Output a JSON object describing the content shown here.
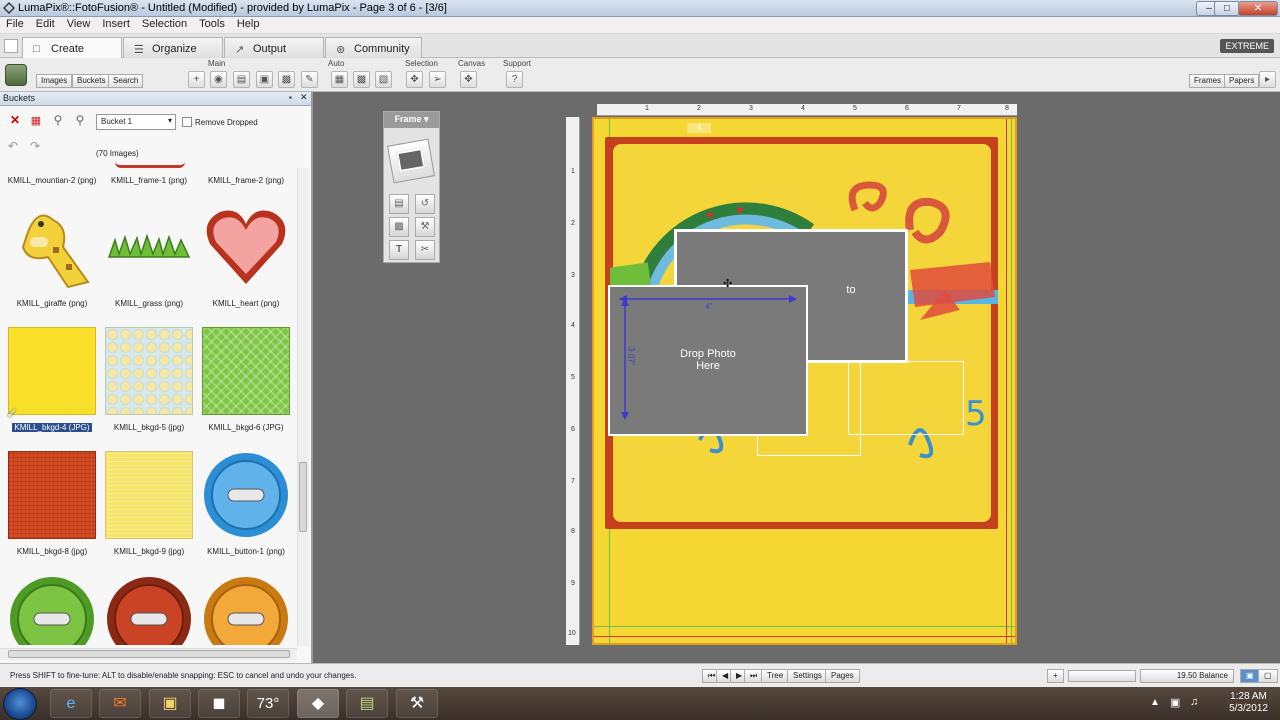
{
  "window": {
    "title": "LumaPix®::FotoFusion® - Untitled (Modified) - provided by LumaPix - Page 3 of 6 - [3/6]",
    "controls": [
      "–",
      "□",
      "✕"
    ]
  },
  "menu": [
    "File",
    "Edit",
    "View",
    "Insert",
    "Selection",
    "Tools",
    "Help"
  ],
  "tabs": [
    {
      "label": "Create",
      "icon": "create-icon"
    },
    {
      "label": "Organize",
      "icon": "list-icon"
    },
    {
      "label": "Output",
      "icon": "output-icon"
    },
    {
      "label": "Community",
      "icon": "community-icon"
    }
  ],
  "edition_badge": "EXTREME",
  "toolbar": {
    "groups": [
      "Main",
      "Auto",
      "Selection",
      "Canvas",
      "Support"
    ],
    "subtabs": [
      "Images",
      "Buckets",
      "Search"
    ],
    "right_buttons": [
      "Frames",
      "Papers"
    ]
  },
  "panel": {
    "title": "Buckets",
    "bucket_select": "Bucket 1",
    "remove_dropped_label": "Remove Dropped",
    "image_count": "(70 Images)",
    "top_captions": [
      "KMILL_mountian-2 (png)",
      "KMILL_frame-1 (png)",
      "KMILL_frame-2 (png)"
    ],
    "items": [
      {
        "caption": "KMILL_giraffe (png)",
        "kind": "giraffe",
        "selected": false
      },
      {
        "caption": "KMILL_grass (png)",
        "kind": "grass",
        "selected": false
      },
      {
        "caption": "KMILL_heart (png)",
        "kind": "heart",
        "selected": false
      },
      {
        "caption": "KMILL_bkgd-4 (JPG)",
        "kind": "yellow",
        "selected": true
      },
      {
        "caption": "KMILL_bkgd-5 (jpg)",
        "kind": "dots",
        "selected": false
      },
      {
        "caption": "KMILL_bkgd-6 (JPG)",
        "kind": "green",
        "selected": false
      },
      {
        "caption": "KMILL_bkgd-8 (jpg)",
        "kind": "red",
        "selected": false
      },
      {
        "caption": "KMILL_bkgd-9 (jpg)",
        "kind": "paleyellow",
        "selected": false
      },
      {
        "caption": "KMILL_button-1 (png)",
        "kind": "bluebutton",
        "selected": false
      },
      {
        "caption": "",
        "kind": "greenbutton",
        "selected": false
      },
      {
        "caption": "",
        "kind": "redbutton",
        "selected": false
      },
      {
        "caption": "",
        "kind": "orangebutton",
        "selected": false
      }
    ]
  },
  "frame_palette": {
    "title": "Frame"
  },
  "canvas": {
    "ruler_top": [
      "1",
      "2",
      "3",
      "4",
      "5",
      "6",
      "7",
      "8"
    ],
    "ruler_left": [
      "1",
      "2",
      "3",
      "4",
      "5",
      "6",
      "7",
      "8",
      "9",
      "10"
    ],
    "page_labels": [
      "4",
      "13"
    ],
    "photo_front_label_line1": "Drop Photo",
    "photo_front_label_line2": "Here",
    "photo_back_label": "to",
    "dim_width": "4\"",
    "dim_height": "3.07\""
  },
  "status": {
    "text": "Press SHIFT to fine-tune: ALT to disable/enable snapping: ESC to cancel and undo your changes.",
    "buttons": [
      "Tree",
      "Settings",
      "Pages"
    ],
    "balance": "19.50 Balance"
  },
  "taskbar": {
    "temperature": "73°",
    "time": "1:28 AM",
    "date": "5/3/2012"
  }
}
